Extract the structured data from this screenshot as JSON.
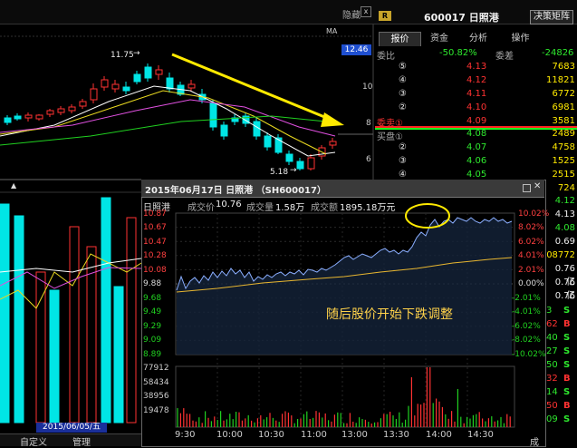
{
  "top_bar": {
    "hide_label": "隐藏",
    "close_glyph": "x",
    "badge": "R",
    "title": "600017 日照港",
    "matrix_button": "决策矩阵"
  },
  "tabs": [
    {
      "label": "报价"
    },
    {
      "label": "资金"
    },
    {
      "label": "分析"
    },
    {
      "label": "操作"
    }
  ],
  "main_chart": {
    "ma_label": "MA",
    "price_tag": "12.46",
    "y_ticks": [
      "10",
      "8",
      "6"
    ],
    "high_label": "11.75",
    "low_label": "5.18",
    "date_tag": "2015/06/05/五"
  },
  "order_book": {
    "wei_bi_label": "委比",
    "wei_bi_value": "-50.82%",
    "wei_cha_label": "委差",
    "wei_cha_value": "-24826",
    "sell_label": "委卖①",
    "buy_label": "买盘①",
    "asks": [
      {
        "level": "⑤",
        "price": "4.13",
        "volume": "7683"
      },
      {
        "level": "④",
        "price": "4.12",
        "volume": "11821"
      },
      {
        "level": "③",
        "price": "4.11",
        "volume": "6772"
      },
      {
        "level": "②",
        "price": "4.10",
        "volume": "6981"
      },
      {
        "level": "①",
        "price": "4.09",
        "volume": "3581"
      }
    ],
    "bids": [
      {
        "level": "①",
        "price": "4.08",
        "volume": "2489"
      },
      {
        "level": "②",
        "price": "4.07",
        "volume": "4758"
      },
      {
        "level": "③",
        "price": "4.06",
        "volume": "1525"
      },
      {
        "level": "④",
        "price": "4.05",
        "volume": "2515"
      },
      {
        "level": "⑤",
        "price": "",
        "volume": "724"
      }
    ]
  },
  "side_values": [
    {
      "v": "4.12",
      "c": "green"
    },
    {
      "v": "4.13",
      "c": "white"
    },
    {
      "v": "4.08",
      "c": "green"
    },
    {
      "v": "0.69",
      "c": "white"
    },
    {
      "v": "08772",
      "c": "yellow"
    },
    {
      "v": "0.76亿",
      "c": "white"
    },
    {
      "v": "0.76亿",
      "c": "white"
    },
    {
      "v": "0.76",
      "c": "white"
    }
  ],
  "trades": [
    {
      "n": "3",
      "k": "S",
      "c": "green"
    },
    {
      "n": "62",
      "k": "B",
      "c": "red"
    },
    {
      "n": "40",
      "k": "S",
      "c": "green"
    },
    {
      "n": "27",
      "k": "S",
      "c": "green"
    },
    {
      "n": "50",
      "k": "S",
      "c": "green"
    },
    {
      "n": "32",
      "k": "B",
      "c": "red"
    },
    {
      "n": "14",
      "k": "S",
      "c": "green"
    },
    {
      "n": "50",
      "k": "B",
      "c": "red"
    },
    {
      "n": "09",
      "k": "S",
      "c": "green"
    }
  ],
  "popup": {
    "title": "2015年06月17日 日照港  （SH600017）",
    "stock_name": "日照港",
    "price_label": "成交价",
    "price_value": "10.76",
    "volume_label": "成交量",
    "volume_value": "1.58万",
    "amount_label": "成交额",
    "amount_value": "1895.18万元",
    "annotation": "随后股价开始下跌调整",
    "y_left": [
      "10.87",
      "10.67",
      "10.47",
      "10.28",
      "10.08",
      "9.88",
      "9.68",
      "9.49",
      "9.29",
      "9.09",
      "8.89"
    ],
    "y_right": [
      "10.02%",
      "8.02%",
      "6.02%",
      "4.01%",
      "2.01%",
      "0.00%",
      "-2.01%",
      "-4.01%",
      "-6.02%",
      "-8.02%",
      "-10.02%"
    ],
    "vol_ticks": [
      "77912",
      "58434",
      "38956",
      "19478"
    ],
    "x_ticks": [
      "9:30",
      "10:00",
      "10:30",
      "11:00",
      "13:00",
      "13:30",
      "14:00",
      "14:30"
    ]
  },
  "left_panel": {
    "y_ticks": [
      "10.87",
      "10.67",
      "10.47",
      "10.28",
      "10.08",
      "9.88",
      "9.68",
      "9.49",
      "9.29",
      "9.09",
      "8.89",
      "77912",
      "58434",
      "38956",
      "19478"
    ]
  },
  "bottom_tabs": [
    {
      "label": "自定义"
    },
    {
      "label": "管理"
    }
  ],
  "corner_label": "成",
  "colors": {
    "up": "#ff3232",
    "down": "#00e5e5",
    "price_line": "#8aaeff",
    "avg_line": "#e8b630",
    "accent": "#ffea00"
  }
}
